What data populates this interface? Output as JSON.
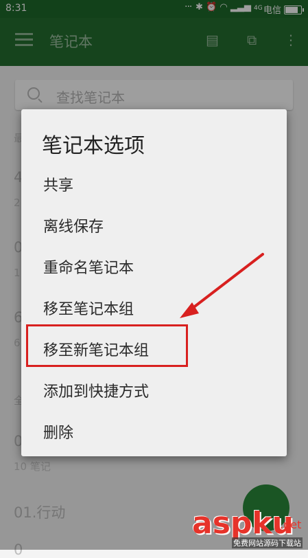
{
  "status_bar": {
    "time": "8:31",
    "network": "4G",
    "carrier": "电信"
  },
  "app_bar": {
    "title": "笔记本"
  },
  "search": {
    "placeholder": "查找笔记本"
  },
  "background_list": {
    "section_recent_fragment": "最",
    "section_all_fragment": "全",
    "rows": [
      {
        "title": "4",
        "sub": "2"
      },
      {
        "title": "0",
        "sub": "1"
      },
      {
        "title": "6",
        "sub": "6"
      },
      {
        "title": "0",
        "sub": "10 笔记"
      },
      {
        "title": "01.行动",
        "sub": ""
      },
      {
        "title": "0",
        "sub": ""
      }
    ]
  },
  "dialog": {
    "title": "笔记本选项",
    "options": [
      "共享",
      "离线保存",
      "重命名笔记本",
      "移至笔记本组",
      "移至新笔记本组",
      "添加到快捷方式",
      "删除"
    ],
    "highlighted_option": "移至新笔记本组"
  },
  "watermark": {
    "brand": "aspku",
    "net": ".net",
    "subtitle": "免费网站源码下载站"
  },
  "colors": {
    "app_bar": "#246f30",
    "highlight": "#d8201f",
    "fab": "#2b8a3a"
  }
}
